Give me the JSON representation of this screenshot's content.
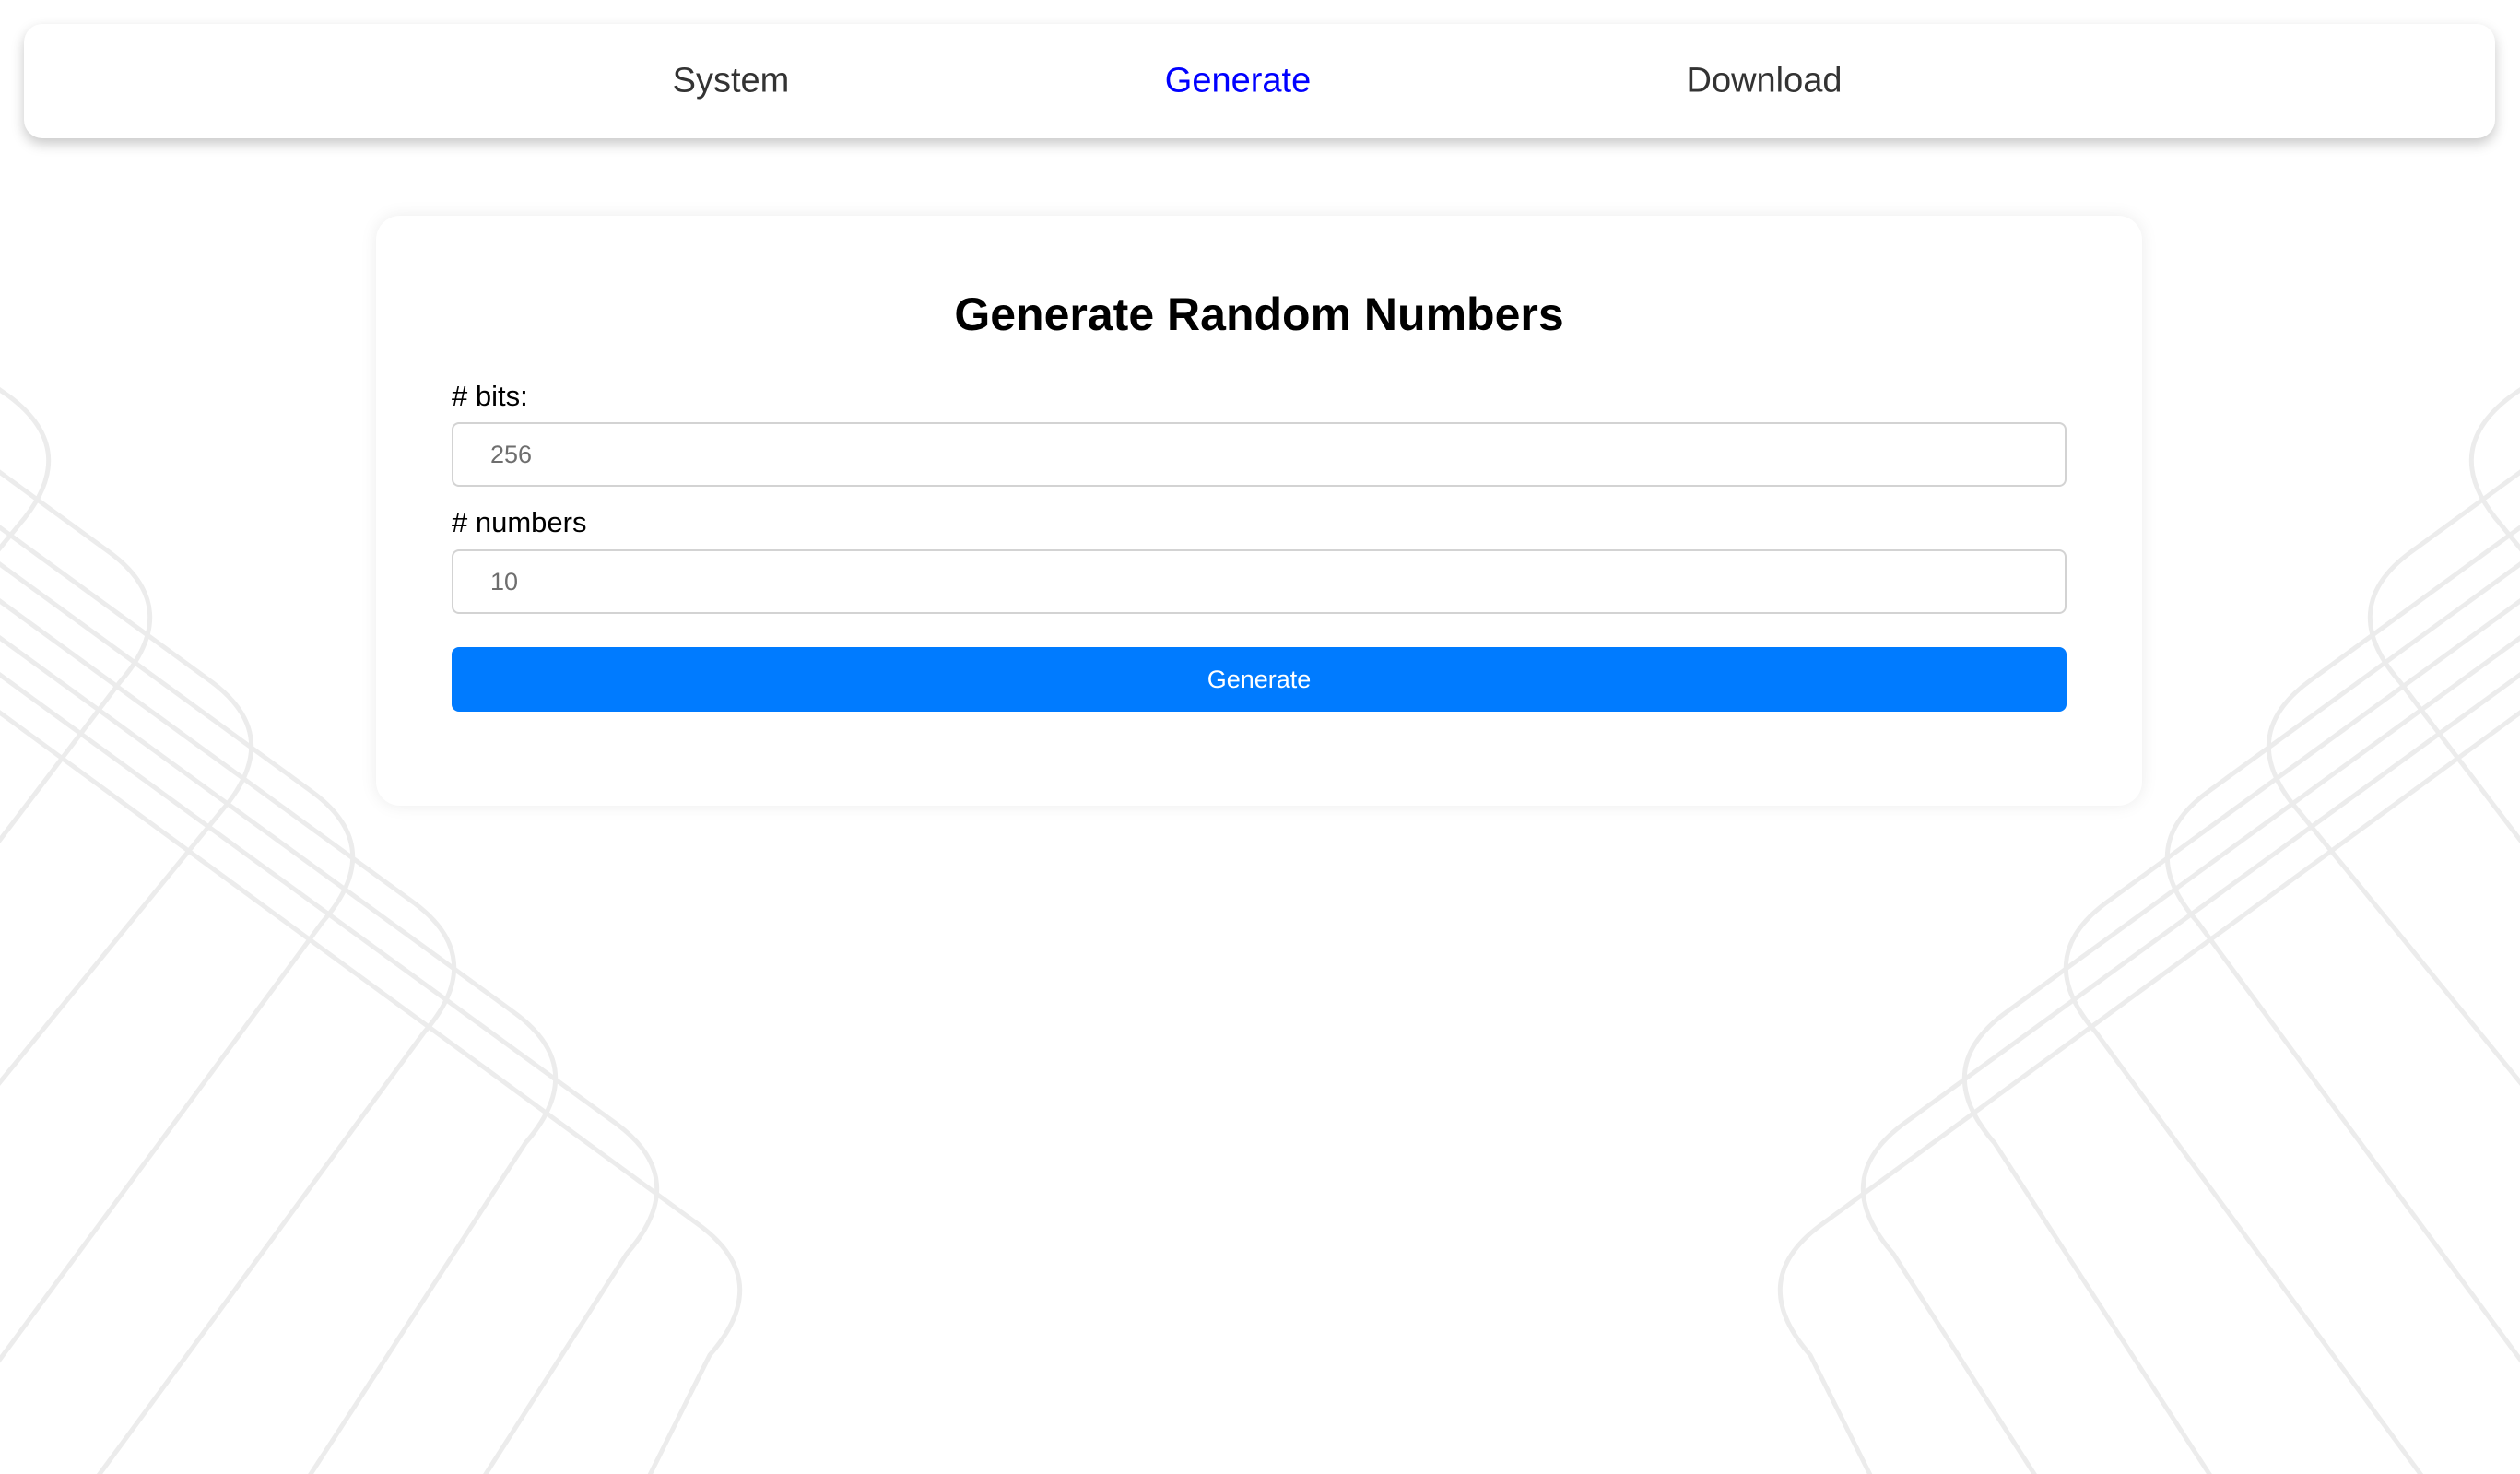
{
  "nav": {
    "items": [
      {
        "label": "System",
        "active": false
      },
      {
        "label": "Generate",
        "active": true
      },
      {
        "label": "Download",
        "active": false
      }
    ]
  },
  "form": {
    "title": "Generate Random Numbers",
    "bits": {
      "label": "# bits:",
      "placeholder": "256",
      "value": ""
    },
    "numbers": {
      "label": "# numbers",
      "placeholder": "10",
      "value": ""
    },
    "submit_label": "Generate"
  },
  "colors": {
    "accent": "#007bff",
    "active_nav": "#0000ff",
    "nav_text": "#333333",
    "background_lines": "#ececec"
  }
}
